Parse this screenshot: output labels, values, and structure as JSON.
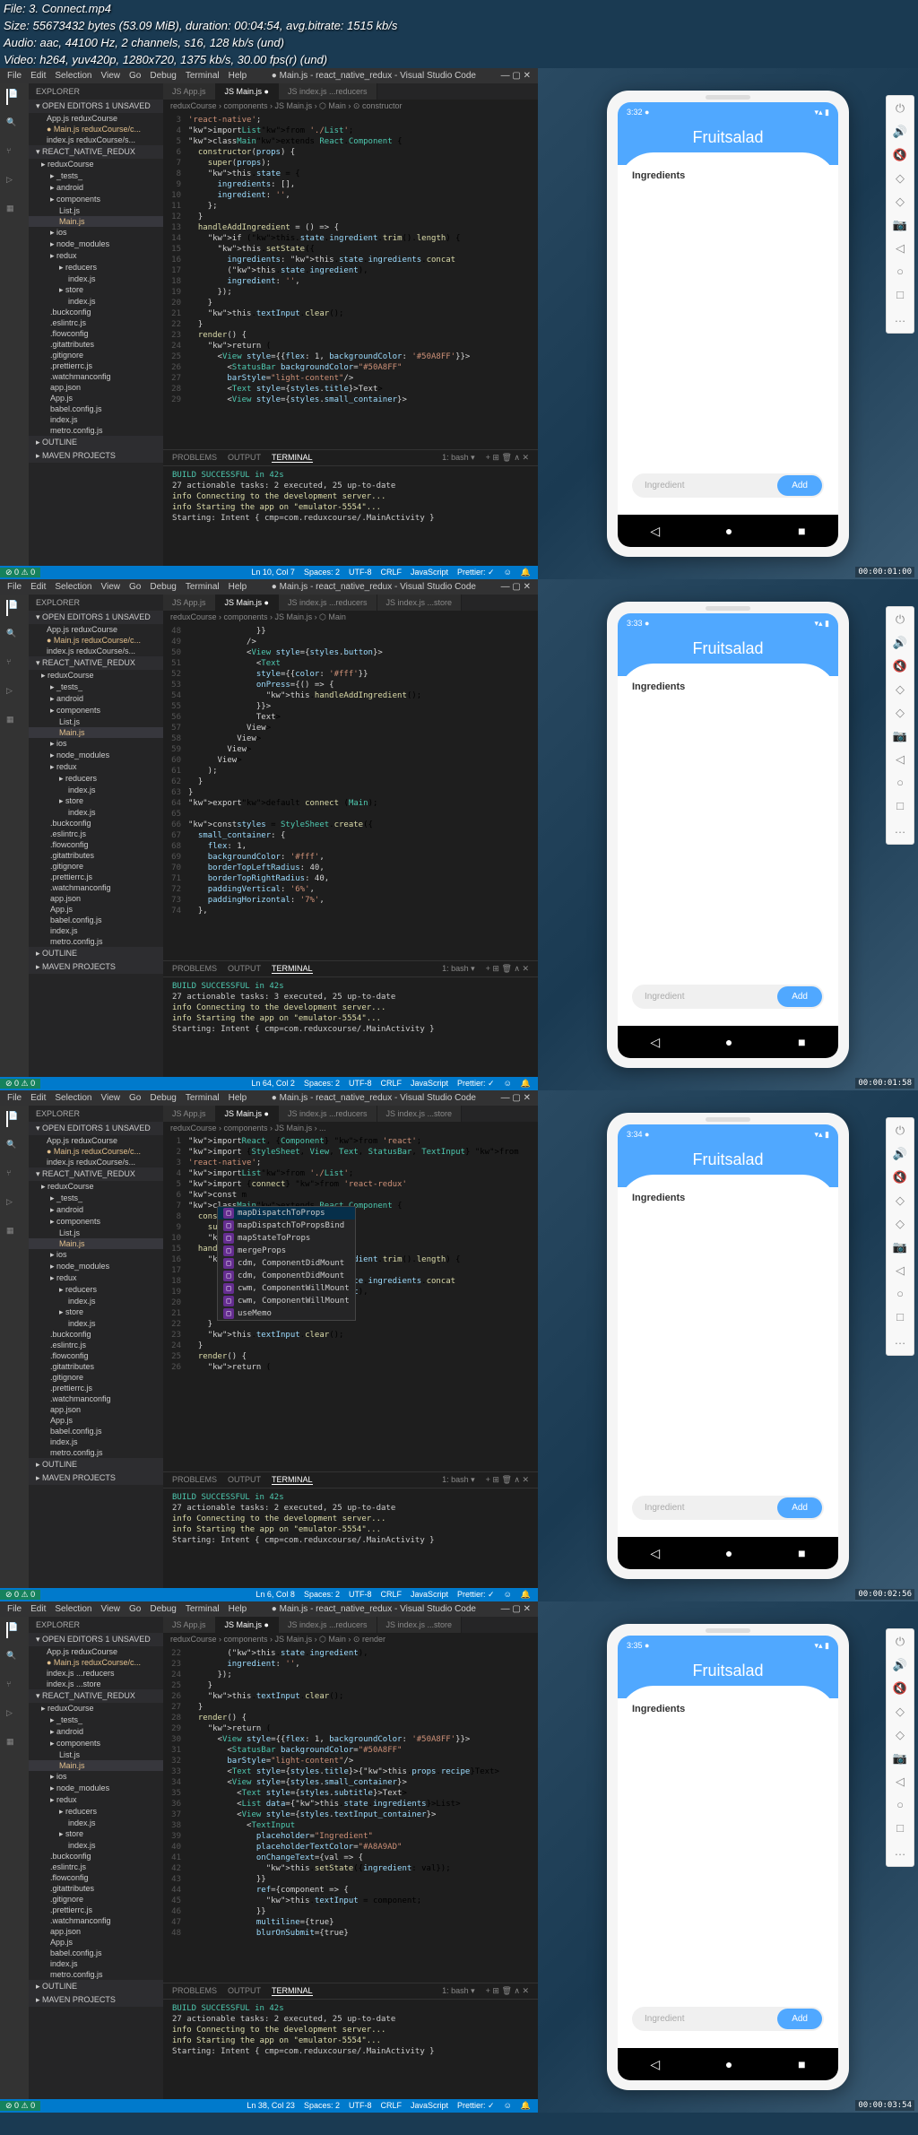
{
  "file_info": {
    "file": "File: 3. Connect.mp4",
    "size": "Size: 55673432 bytes (53.09 MiB), duration: 00:04:54, avg.bitrate: 1515 kb/s",
    "audio": "Audio: aac, 44100 Hz, 2 channels, s16, 128 kb/s (und)",
    "video": "Video: h264, yuv420p, 1280x720, 1375 kb/s, 30.00 fps(r) (und)"
  },
  "menubar": [
    "File",
    "Edit",
    "Selection",
    "View",
    "Go",
    "Debug",
    "Terminal",
    "Help"
  ],
  "window_title": "● Main.js - react_native_redux - Visual Studio Code",
  "sidebar": {
    "title": "EXPLORER",
    "open_editors": "OPEN EDITORS  1 UNSAVED",
    "editors": [
      "App.js reduxCourse",
      "● Main.js reduxCourse/c...",
      "index.js reduxCourse/s..."
    ],
    "editors_f4": [
      "App.js reduxCourse",
      "● Main.js reduxCourse/c...",
      "index.js ...reducers",
      "index.js ...store"
    ],
    "project": "REACT_NATIVE_REDUX",
    "tree": [
      {
        "name": "reduxCourse",
        "type": "folder"
      },
      {
        "name": "_tests_",
        "type": "folder",
        "indent": 1
      },
      {
        "name": "android",
        "type": "folder",
        "indent": 1
      },
      {
        "name": "components",
        "type": "folder",
        "indent": 1
      },
      {
        "name": "List.js",
        "type": "file",
        "indent": 2
      },
      {
        "name": "Main.js",
        "type": "file",
        "indent": 2,
        "active": true,
        "modified": true
      },
      {
        "name": "ios",
        "type": "folder",
        "indent": 1
      },
      {
        "name": "node_modules",
        "type": "folder",
        "indent": 1
      },
      {
        "name": "redux",
        "type": "folder",
        "indent": 1
      },
      {
        "name": "reducers",
        "type": "folder",
        "indent": 2
      },
      {
        "name": "index.js",
        "type": "file",
        "indent": 3
      },
      {
        "name": "store",
        "type": "folder",
        "indent": 2
      },
      {
        "name": "index.js",
        "type": "file",
        "indent": 3
      },
      {
        "name": ".buckconfig",
        "type": "file",
        "indent": 1
      },
      {
        "name": ".eslintrc.js",
        "type": "file",
        "indent": 1
      },
      {
        "name": ".flowconfig",
        "type": "file",
        "indent": 1
      },
      {
        "name": ".gitattributes",
        "type": "file",
        "indent": 1
      },
      {
        "name": ".gitignore",
        "type": "file",
        "indent": 1
      },
      {
        "name": ".prettierrc.js",
        "type": "file",
        "indent": 1
      },
      {
        "name": ".watchmanconfig",
        "type": "file",
        "indent": 1
      },
      {
        "name": "app.json",
        "type": "file",
        "indent": 1
      },
      {
        "name": "App.js",
        "type": "file",
        "indent": 1
      },
      {
        "name": "babel.config.js",
        "type": "file",
        "indent": 1
      },
      {
        "name": "index.js",
        "type": "file",
        "indent": 1
      },
      {
        "name": "metro.config.js",
        "type": "file",
        "indent": 1
      }
    ],
    "outline": "OUTLINE",
    "maven": "MAVEN PROJECTS"
  },
  "tabs": [
    {
      "name": "App.js",
      "active": false
    },
    {
      "name": "Main.js",
      "active": true,
      "modified": true
    },
    {
      "name": "index.js ...reducers",
      "active": false
    },
    {
      "name": "index.js ...store",
      "active": false
    }
  ],
  "frames": [
    {
      "breadcrumb": "reduxCourse › components › JS Main.js › ⬡ Main › ⊙ constructor",
      "timestamp": "00:00:01:00",
      "phone_time": "3:32",
      "status": {
        "left": "⊘ 0 ⚠ 0",
        "pos": "Ln 10, Col 7",
        "right": [
          "Spaces: 2",
          "UTF-8",
          "CRLF",
          "JavaScript",
          "Prettier: ✓",
          "☺",
          "🔔"
        ]
      },
      "code": [
        {
          "n": "3",
          "t": "'react-native';",
          "c": "str"
        },
        {
          "n": "4",
          "t": "import List from './List';",
          "c": ""
        },
        {
          "n": "5",
          "t": "class Main extends React.Component {",
          "c": ""
        },
        {
          "n": "6",
          "t": "  constructor(props) {",
          "c": ""
        },
        {
          "n": "7",
          "t": "    super(props);",
          "c": ""
        },
        {
          "n": "8",
          "t": "    this.state = {",
          "c": ""
        },
        {
          "n": "9",
          "t": "      ingredients: [],",
          "c": ""
        },
        {
          "n": "10",
          "t": "      ingredient: '',",
          "c": ""
        },
        {
          "n": "11",
          "t": "    };",
          "c": ""
        },
        {
          "n": "12",
          "t": "  }",
          "c": ""
        },
        {
          "n": "13",
          "t": "  handleAddIngredient = () => {",
          "c": ""
        },
        {
          "n": "14",
          "t": "    if (this.state.ingredient.trim().length) {",
          "c": ""
        },
        {
          "n": "15",
          "t": "      this.setState({",
          "c": ""
        },
        {
          "n": "16",
          "t": "        ingredients: this.state.ingredients.concat",
          "c": ""
        },
        {
          "n": "17",
          "t": "        (this.state.ingredient),",
          "c": ""
        },
        {
          "n": "18",
          "t": "        ingredient: '',",
          "c": ""
        },
        {
          "n": "19",
          "t": "      });",
          "c": ""
        },
        {
          "n": "20",
          "t": "    }",
          "c": ""
        },
        {
          "n": "21",
          "t": "    this.textInput.clear();",
          "c": ""
        },
        {
          "n": "22",
          "t": "  }",
          "c": ""
        },
        {
          "n": "23",
          "t": "  render() {",
          "c": ""
        },
        {
          "n": "24",
          "t": "    return (",
          "c": ""
        },
        {
          "n": "25",
          "t": "      <View style={{flex: 1, backgroundColor: '#50A8FF'}}>",
          "c": ""
        },
        {
          "n": "26",
          "t": "        <StatusBar backgroundColor=\"#50A8FF\"",
          "c": ""
        },
        {
          "n": "27",
          "t": "        barStyle=\"light-content\"/>",
          "c": ""
        },
        {
          "n": "28",
          "t": "        <Text style={styles.title}></Text>",
          "c": ""
        },
        {
          "n": "29",
          "t": "        <View style={styles.small_container}>",
          "c": ""
        }
      ]
    },
    {
      "breadcrumb": "reduxCourse › components › JS Main.js › ⬡ Main",
      "timestamp": "00:00:01:58",
      "phone_time": "3:33",
      "status": {
        "left": "⊘ 0 ⚠ 0",
        "pos": "Ln 64, Col 2",
        "right": [
          "Spaces: 2",
          "UTF-8",
          "CRLF",
          "JavaScript",
          "Prettier: ✓",
          "☺",
          "🔔"
        ]
      },
      "code": [
        {
          "n": "48",
          "t": "              }}",
          "c": ""
        },
        {
          "n": "49",
          "t": "            />",
          "c": ""
        },
        {
          "n": "50",
          "t": "            <View style={styles.button}>",
          "c": ""
        },
        {
          "n": "51",
          "t": "              <Text",
          "c": ""
        },
        {
          "n": "52",
          "t": "              style={{color: '#fff'}}",
          "c": ""
        },
        {
          "n": "53",
          "t": "              onPress={() => {",
          "c": ""
        },
        {
          "n": "54",
          "t": "                this.handleAddIngredient();",
          "c": ""
        },
        {
          "n": "55",
          "t": "              }}>",
          "c": ""
        },
        {
          "n": "56",
          "t": "              </Text>",
          "c": ""
        },
        {
          "n": "57",
          "t": "            </View>",
          "c": ""
        },
        {
          "n": "58",
          "t": "          </View>",
          "c": ""
        },
        {
          "n": "59",
          "t": "        </View>",
          "c": ""
        },
        {
          "n": "60",
          "t": "      </View>",
          "c": ""
        },
        {
          "n": "61",
          "t": "    );",
          "c": ""
        },
        {
          "n": "62",
          "t": "  }",
          "c": ""
        },
        {
          "n": "63",
          "t": "}",
          "c": ""
        },
        {
          "n": "64",
          "t": "export default connect (Main);",
          "c": ""
        },
        {
          "n": "65",
          "t": "",
          "c": ""
        },
        {
          "n": "66",
          "t": "const styles = StyleSheet.create({",
          "c": ""
        },
        {
          "n": "67",
          "t": "  small_container: {",
          "c": ""
        },
        {
          "n": "68",
          "t": "    flex: 1,",
          "c": ""
        },
        {
          "n": "69",
          "t": "    backgroundColor: '#fff',",
          "c": ""
        },
        {
          "n": "70",
          "t": "    borderTopLeftRadius: 40,",
          "c": ""
        },
        {
          "n": "71",
          "t": "    borderTopRightRadius: 40,",
          "c": ""
        },
        {
          "n": "72",
          "t": "    paddingVertical: '6%',",
          "c": ""
        },
        {
          "n": "73",
          "t": "    paddingHorizontal: '7%',",
          "c": ""
        },
        {
          "n": "74",
          "t": "  },",
          "c": ""
        }
      ]
    },
    {
      "breadcrumb": "reduxCourse › components › JS Main.js › ...",
      "timestamp": "00:00:02:56",
      "phone_time": "3:34",
      "status": {
        "left": "⊘ 0 ⚠ 0",
        "pos": "Ln 6, Col 8",
        "right": [
          "Spaces: 2",
          "UTF-8",
          "CRLF",
          "JavaScript",
          "Prettier: ✓",
          "☺",
          "🔔"
        ]
      },
      "code": [
        {
          "n": "1",
          "t": "import React, {Component} from 'react';",
          "c": ""
        },
        {
          "n": "2",
          "t": "import {StyleSheet, View, Text, StatusBar, TextInput} from",
          "c": ""
        },
        {
          "n": "3",
          "t": "'react-native';",
          "c": ""
        },
        {
          "n": "4",
          "t": "import List from './List';",
          "c": ""
        },
        {
          "n": "5",
          "t": "import {connect} from 'react-redux'",
          "c": ""
        },
        {
          "n": "6",
          "t": "const m",
          "c": ""
        },
        {
          "n": "7",
          "t": "class Main extends React.Component {",
          "c": ""
        },
        {
          "n": "8",
          "t": "  constructor(props) {",
          "c": ""
        },
        {
          "n": "9",
          "t": "    super(props);",
          "c": ""
        },
        {
          "n": "10",
          "t": "    this.state = {",
          "c": ""
        }
      ],
      "autocomplete": [
        {
          "icon": "□",
          "label": "mapDispatchToProps",
          "selected": true
        },
        {
          "icon": "□",
          "label": "mapDispatchToPropsBind"
        },
        {
          "icon": "□",
          "label": "mapStateToProps"
        },
        {
          "icon": "□",
          "label": "mergeProps"
        },
        {
          "icon": "□",
          "label": "cdm, ComponentDidMount"
        },
        {
          "icon": "□",
          "label": "cdm, ComponentDidMount"
        },
        {
          "icon": "□",
          "label": "cwm, ComponentWillMount"
        },
        {
          "icon": "□",
          "label": "cwm, ComponentWillMount"
        },
        {
          "icon": "□",
          "label": "useMemo"
        }
      ],
      "code2": [
        {
          "n": "15",
          "t": "  handleAddIngredient = () => {",
          "c": ""
        },
        {
          "n": "16",
          "t": "    if (this.state.ingredient.trim().length) {",
          "c": ""
        },
        {
          "n": "17",
          "t": "      this.setState({",
          "c": ""
        },
        {
          "n": "18",
          "t": "        ingredients: this.state.ingredients.concat",
          "c": ""
        },
        {
          "n": "19",
          "t": "        (this.state.ingredient),",
          "c": ""
        },
        {
          "n": "20",
          "t": "        ingredient: '',",
          "c": ""
        },
        {
          "n": "21",
          "t": "      });",
          "c": ""
        },
        {
          "n": "22",
          "t": "    }",
          "c": ""
        },
        {
          "n": "23",
          "t": "    this.textInput.clear();",
          "c": ""
        },
        {
          "n": "24",
          "t": "  }",
          "c": ""
        },
        {
          "n": "25",
          "t": "  render() {",
          "c": ""
        },
        {
          "n": "26",
          "t": "    return (",
          "c": ""
        }
      ]
    },
    {
      "breadcrumb": "reduxCourse › components › JS Main.js › ⬡ Main › ⊙ render",
      "timestamp": "00:00:03:54",
      "phone_time": "3:35",
      "status": {
        "left": "⊘ 0 ⚠ 0",
        "pos": "Ln 38, Col 23",
        "right": [
          "Spaces: 2",
          "UTF-8",
          "CRLF",
          "JavaScript",
          "Prettier: ✓",
          "☺",
          "🔔"
        ]
      },
      "code": [
        {
          "n": "22",
          "t": "        (this.state.ingredient),",
          "c": ""
        },
        {
          "n": "23",
          "t": "        ingredient: '',",
          "c": ""
        },
        {
          "n": "24",
          "t": "      });",
          "c": ""
        },
        {
          "n": "25",
          "t": "    }",
          "c": ""
        },
        {
          "n": "26",
          "t": "    this.textInput.clear();",
          "c": ""
        },
        {
          "n": "27",
          "t": "  }",
          "c": ""
        },
        {
          "n": "28",
          "t": "  render() {",
          "c": ""
        },
        {
          "n": "29",
          "t": "    return (",
          "c": ""
        },
        {
          "n": "30",
          "t": "      <View style={{flex: 1, backgroundColor: '#50A8FF'}}>",
          "c": ""
        },
        {
          "n": "31",
          "t": "        <StatusBar backgroundColor=\"#50A8FF\"",
          "c": ""
        },
        {
          "n": "32",
          "t": "        barStyle=\"light-content\"/>",
          "c": ""
        },
        {
          "n": "33",
          "t": "        <Text style={styles.title}>{this.props.recipe}</Text>",
          "c": ""
        },
        {
          "n": "34",
          "t": "        <View style={styles.small_container}>",
          "c": ""
        },
        {
          "n": "35",
          "t": "          <Text style={styles.subtitle}></Text>",
          "c": ""
        },
        {
          "n": "36",
          "t": "          <List data={this.state.ingredients}></List>",
          "c": ""
        },
        {
          "n": "37",
          "t": "          <View style={styles.textInput_container}>",
          "c": ""
        },
        {
          "n": "38",
          "t": "            <TextInput",
          "c": ""
        },
        {
          "n": "39",
          "t": "              placeholder=\"Ingredient\"",
          "c": ""
        },
        {
          "n": "40",
          "t": "              placeholderTextColor=\"#A8A9AD\"",
          "c": ""
        },
        {
          "n": "41",
          "t": "              onChangeText={val => {",
          "c": ""
        },
        {
          "n": "42",
          "t": "                this.setState({ingredient: val});",
          "c": ""
        },
        {
          "n": "43",
          "t": "              }}",
          "c": ""
        },
        {
          "n": "44",
          "t": "              ref={component => {",
          "c": ""
        },
        {
          "n": "45",
          "t": "                this.textInput = component;",
          "c": ""
        },
        {
          "n": "46",
          "t": "              }}",
          "c": ""
        },
        {
          "n": "47",
          "t": "              multiline={true}",
          "c": ""
        },
        {
          "n": "48",
          "t": "              blurOnSubmit={true}",
          "c": ""
        }
      ]
    }
  ],
  "terminal": {
    "tabs": [
      "PROBLEMS",
      "OUTPUT",
      "TERMINAL"
    ],
    "shell": "1: bash",
    "lines": [
      {
        "t": "BUILD SUCCESSFUL in 42s",
        "c": "green"
      },
      {
        "t": "27 actionable tasks: 2 executed, 25 up-to-date",
        "c": ""
      },
      {
        "t": "info Connecting to the development server...",
        "c": "yellow"
      },
      {
        "t": "info Starting the app on \"emulator-5554\"...",
        "c": "yellow"
      },
      {
        "t": "Starting: Intent { cmp=com.reduxcourse/.MainActivity }",
        "c": ""
      }
    ],
    "lines_alt": [
      {
        "t": "BUILD SUCCESSFUL in 42s",
        "c": "green"
      },
      {
        "t": "27 actionable tasks: 3 executed, 25 up-to-date",
        "c": ""
      },
      {
        "t": "info Connecting to the development server...",
        "c": "yellow"
      },
      {
        "t": "info Starting the app on \"emulator-5554\"...",
        "c": "yellow"
      },
      {
        "t": "Starting: Intent { cmp=com.reduxcourse/.MainActivity }",
        "c": ""
      }
    ]
  },
  "phone": {
    "app_title": "Fruitsalad",
    "subtitle": "Ingredients",
    "placeholder": "Ingredient",
    "add_btn": "Add"
  },
  "emulator_icons": [
    "⏻",
    "🔊",
    "🔇",
    "◇",
    "◇",
    "📷",
    "◁",
    "○",
    "□",
    "…"
  ]
}
